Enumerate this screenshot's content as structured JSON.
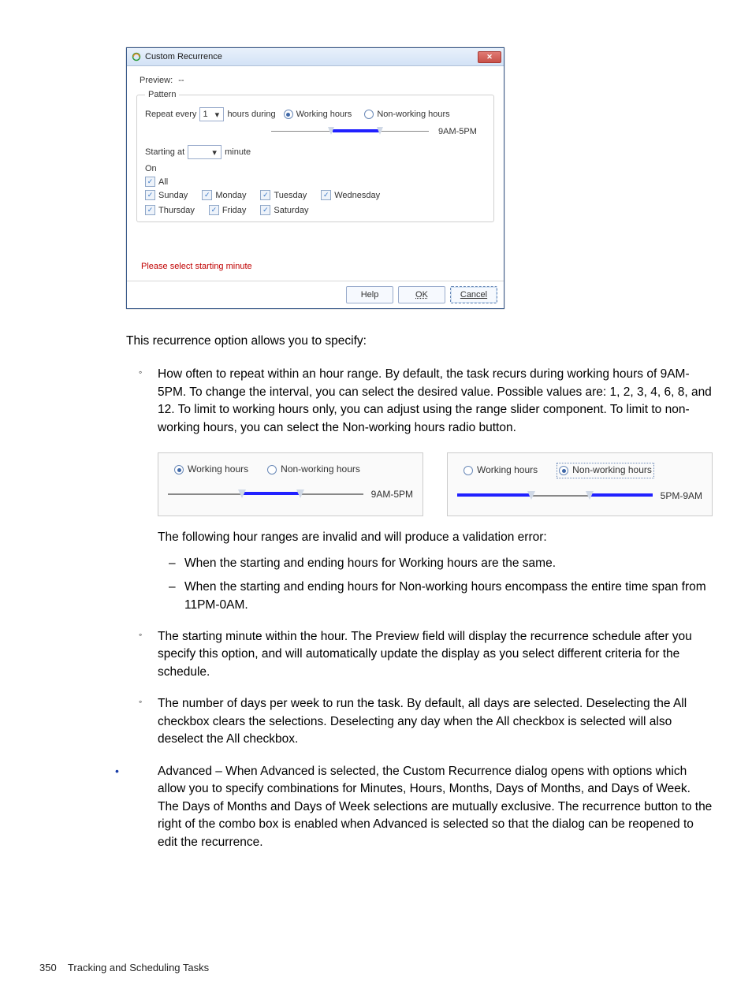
{
  "dialog": {
    "title": "Custom Recurrence",
    "preview_label": "Preview:",
    "preview_value": "--",
    "pattern_legend": "Pattern",
    "repeat_label_pre": "Repeat every",
    "repeat_value": "1",
    "repeat_label_post": "hours during",
    "radio_working": "Working hours",
    "radio_nonworking": "Non-working hours",
    "slider_label": "9AM-5PM",
    "starting_at": "Starting at",
    "starting_post": "minute",
    "on_label": "On",
    "all_label": "All",
    "days": [
      "Sunday",
      "Monday",
      "Tuesday",
      "Wednesday",
      "Thursday",
      "Friday",
      "Saturday"
    ],
    "error": "Please select starting minute",
    "btn_help": "Help",
    "btn_ok": "OK",
    "btn_cancel": "Cancel"
  },
  "para_intro": "This recurrence option allows you to specify:",
  "bullets": {
    "b1": "How often to repeat within an hour range. By default, the task recurs during working hours of 9AM-5PM. To change the interval, you can select the desired value. Possible values are: 1, 2, 3, 4, 6, 8, and 12. To limit to working hours only, you can adjust using the range slider component. To limit to non-working hours, you can select the Non-working hours radio button.",
    "b1_invalid_intro": "The following hour ranges are invalid and will produce a validation error:",
    "b1_err1": "When the starting and ending hours for Working hours are the same.",
    "b1_err2": "When the starting and ending hours for Non-working hours encompass the entire time span from 11PM-0AM.",
    "b2_pre": "The starting minute within the hour. The ",
    "b2_bold": "Preview",
    "b2_post": " field will display the recurrence schedule after you specify this option, and will automatically update the display as you select different criteria for the schedule.",
    "b3": "The number of days per week to run the task. By default, all days are selected. Deselecting the All checkbox clears the selections. Deselecting any day when the All checkbox is selected will also deselect the All checkbox.",
    "b4_bold": "Advanced",
    "b4_post": " – When Advanced is selected, the Custom Recurrence dialog opens with options which allow you to specify combinations for Minutes, Hours, Months, Days of Months, and Days of Week. The Days of Months and Days of Week selections are mutually exclusive. The recurrence button to the right of the combo box is enabled when Advanced is selected so that the dialog can be reopened to edit the recurrence."
  },
  "mini": {
    "working": "Working hours",
    "nonworking": "Non-working hours",
    "label1": "9AM-5PM",
    "label2": "5PM-9AM"
  },
  "footer": {
    "page": "350",
    "section": "Tracking and Scheduling Tasks"
  }
}
